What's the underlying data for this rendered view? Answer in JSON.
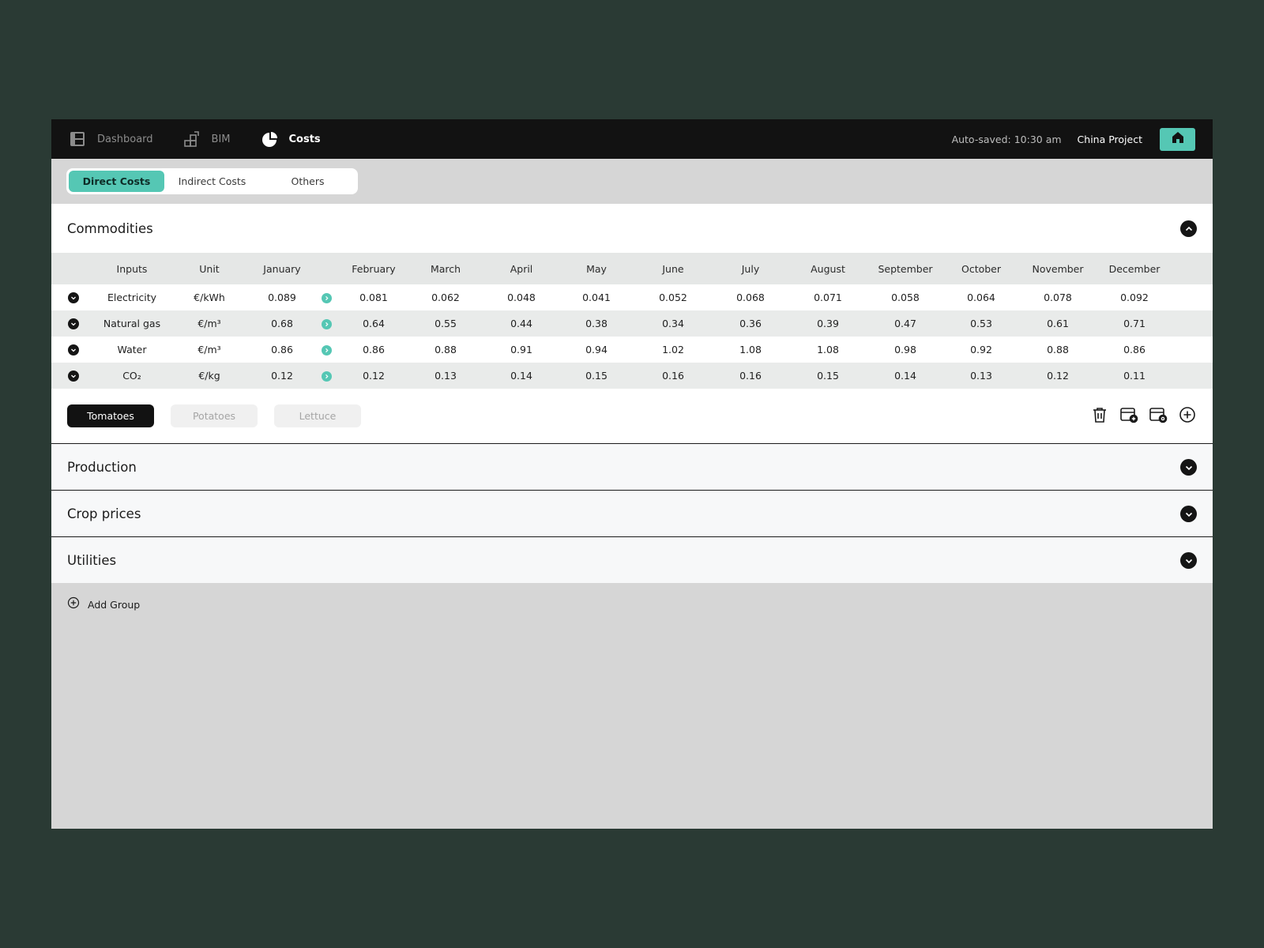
{
  "nav": {
    "items": [
      {
        "label": "Dashboard",
        "icon": "dashboard-icon"
      },
      {
        "label": "BIM",
        "icon": "bim-icon"
      },
      {
        "label": "Costs",
        "icon": "pie-chart-icon"
      }
    ],
    "autosave": "Auto-saved: 10:30 am",
    "project": "China Project",
    "home_icon": "home-icon"
  },
  "cost_tabs": [
    "Direct Costs",
    "Indirect Costs",
    "Others"
  ],
  "commodities": {
    "title": "Commodities",
    "columns": [
      "Inputs",
      "Unit",
      "January",
      "February",
      "March",
      "April",
      "May",
      "June",
      "July",
      "August",
      "September",
      "October",
      "November",
      "December"
    ],
    "rows": [
      {
        "input": "Electricity",
        "unit": "€/kWh",
        "values": [
          "0.089",
          "0.081",
          "0.062",
          "0.048",
          "0.041",
          "0.052",
          "0.068",
          "0.071",
          "0.058",
          "0.064",
          "0.078",
          "0.092"
        ]
      },
      {
        "input": "Natural gas",
        "unit": "€/m³",
        "values": [
          "0.68",
          "0.64",
          "0.55",
          "0.44",
          "0.38",
          "0.34",
          "0.36",
          "0.39",
          "0.47",
          "0.53",
          "0.61",
          "0.71"
        ]
      },
      {
        "input": "Water",
        "unit": "€/m³",
        "values": [
          "0.86",
          "0.86",
          "0.88",
          "0.91",
          "0.94",
          "1.02",
          "1.08",
          "1.08",
          "0.98",
          "0.92",
          "0.88",
          "0.86"
        ]
      },
      {
        "input": "CO₂",
        "unit": "€/kg",
        "values": [
          "0.12",
          "0.12",
          "0.13",
          "0.14",
          "0.15",
          "0.16",
          "0.16",
          "0.15",
          "0.14",
          "0.13",
          "0.12",
          "0.11"
        ]
      }
    ],
    "crops": [
      "Tomatoes",
      "Potatoes",
      "Lettuce"
    ],
    "active_crop": "Tomatoes"
  },
  "sections": [
    "Production",
    "Crop prices",
    "Utilities"
  ],
  "add_group": "Add Group",
  "colors": {
    "accent": "#55c7b4",
    "nav_bg": "#121212",
    "page_bg": "#2a3a34"
  }
}
